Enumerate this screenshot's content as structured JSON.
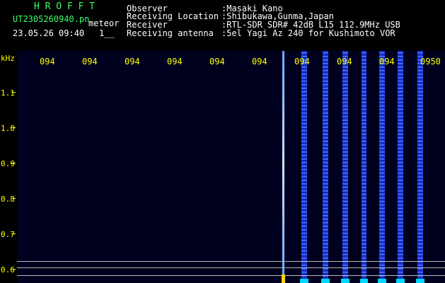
{
  "header": {
    "app_name": "H R O F F T",
    "file_name": "UT2305260940.pn",
    "mode": "meteor",
    "datetime": "23.05.26 09:40",
    "counter": "1__",
    "fields": [
      {
        "label": "Observer",
        "value": ":Masaki Kano"
      },
      {
        "label": "Receiving Location",
        "value": ":Shibukawa,Gunma,Japan"
      },
      {
        "label": "Receiver",
        "value": ":RTL-SDR SDR# 42dB L15 112.9MHz USB"
      },
      {
        "label": "Receiving antenna",
        "value": ":5el Yagi Az 240 for Kushimoto VOR"
      }
    ]
  },
  "axis": {
    "unit": "kHz",
    "y_labels": [
      "1.1",
      "1.0",
      "0.9",
      "0.8",
      "0.7",
      "0.6"
    ],
    "x_labels": [
      "094",
      "094",
      "094",
      "094",
      "094",
      "094",
      "094",
      "094",
      "094",
      "0950"
    ]
  },
  "colors": {
    "text_green": "#39ff6a",
    "text_white": "#ffffff",
    "text_yellow": "#ffff00",
    "signal_blue": "#2a4cff",
    "signal_cyan": "#00d8ff"
  }
}
